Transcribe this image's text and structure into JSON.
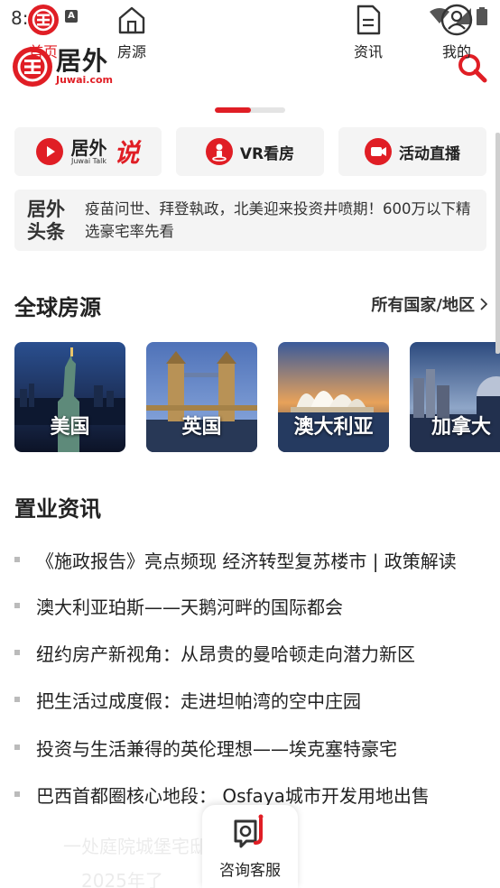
{
  "status_bar": {
    "time": "8:46",
    "notification_letter": "A"
  },
  "header": {
    "logo_cn": "居外",
    "logo_en": "Juwai.com"
  },
  "quick_links": {
    "talk_cn": "居外",
    "talk_en": "Juwai Talk",
    "talk_suffix": "说",
    "vr_label": "VR看房",
    "live_label": "活动直播"
  },
  "headline": {
    "tag": "居外头条",
    "text": "疫苗问世、拜登執政，北美迎来投资井喷期！600万以下精选豪宅率先看"
  },
  "global": {
    "title": "全球房源",
    "all_countries": "所有国家/地区",
    "countries": [
      {
        "name": "美国"
      },
      {
        "name": "英国"
      },
      {
        "name": "澳大利亚"
      },
      {
        "name": "加拿大"
      }
    ]
  },
  "news": {
    "title": "置业资讯",
    "items": [
      "《施政报告》亮点频现 经济转型复苏楼市 | 政策解读",
      "澳大利亚珀斯——天鹅河畔的国际都会",
      "纽约房产新视角：从昂贵的曼哈顿走向潜力新区",
      "把生活过成度假：走进坦帕湾的空中庄园",
      "投资与生活兼得的英伦理想——埃克塞特豪宅",
      "巴西首都圈核心地段： Osfaya城市开发用地出售"
    ]
  },
  "ghost_text": {
    "line1": "一处庭院城堡宅邸的优雅生活",
    "line2": "2025年了"
  },
  "bottom_nav": {
    "home": "首页",
    "listings": "房源",
    "consult": "咨询客服",
    "news": "资讯",
    "mine": "我的"
  },
  "colors": {
    "brand_red": "#e01e25",
    "card_bg": "#f4f4f4"
  }
}
